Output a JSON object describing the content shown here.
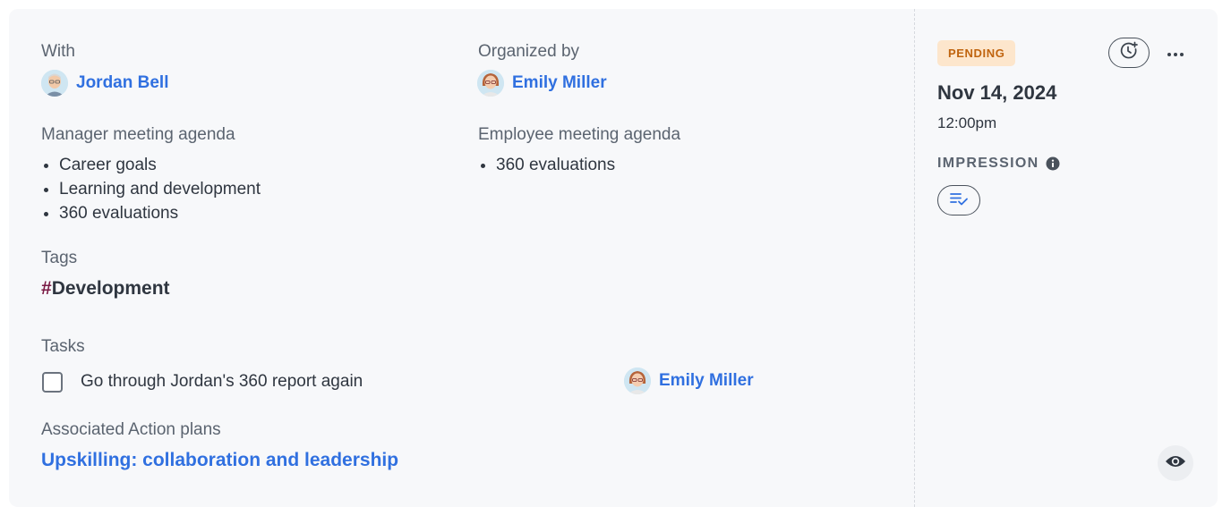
{
  "details": {
    "with_label": "With",
    "with_person": "Jordan Bell",
    "organized_label": "Organized by",
    "organizer": "Emily Miller",
    "manager_agenda_label": "Manager meeting agenda",
    "manager_agenda": [
      "Career goals",
      "Learning and development",
      "360 evaluations"
    ],
    "employee_agenda_label": "Employee meeting agenda",
    "employee_agenda": [
      "360 evaluations"
    ],
    "tags_label": "Tags",
    "tag_hash": "#",
    "tag_name": "Development",
    "tasks_label": "Tasks",
    "task_text": "Go through Jordan's 360 report again",
    "task_assignee": "Emily Miller",
    "action_plans_label": "Associated Action plans",
    "action_plan": "Upskilling: collaboration and leadership"
  },
  "sidebar": {
    "status": "PENDING",
    "date": "Nov 14, 2024",
    "time": "12:00pm",
    "impression_label": "IMPRESSION"
  },
  "icons": {
    "reschedule": "clock-plus-icon",
    "more": "more-dots-icon",
    "info": "info-icon",
    "impression": "list-check-icon",
    "view": "eye-icon"
  },
  "colors": {
    "link": "#3070e0",
    "pending_bg": "#fde6cc",
    "pending_text": "#c0640f",
    "hash": "#7a1a45",
    "card_bg": "#f7f8fa"
  }
}
